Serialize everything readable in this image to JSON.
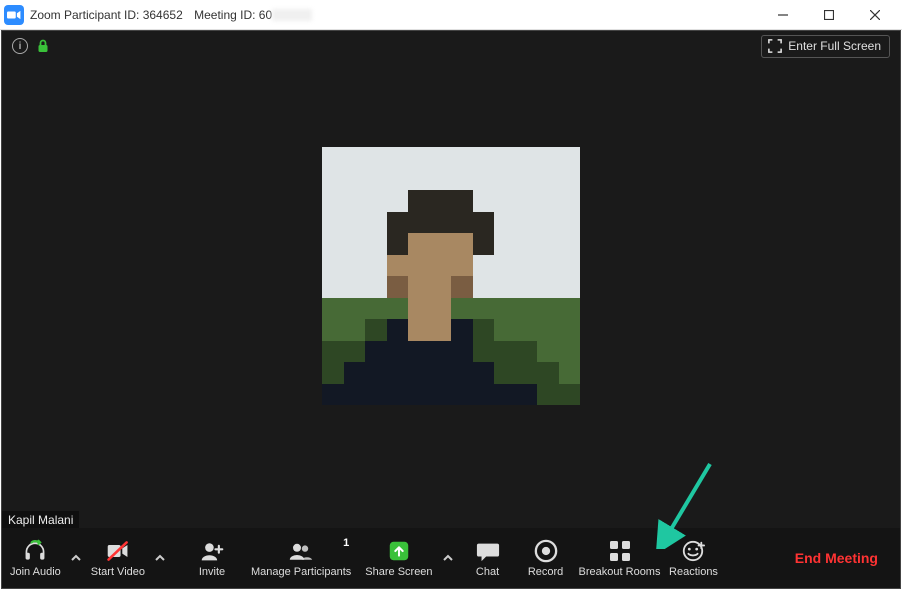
{
  "titlebar": {
    "participant_id_label": "Zoom Participant ID: 364652",
    "meeting_id_label": "Meeting ID: 60"
  },
  "topstrip": {
    "fullscreen_label": "Enter Full Screen"
  },
  "video": {
    "participant_name": "Kapil Malani"
  },
  "toolbar": {
    "join_audio": "Join Audio",
    "start_video": "Start Video",
    "invite": "Invite",
    "manage_participants": "Manage Participants",
    "participants_count": "1",
    "share_screen": "Share Screen",
    "chat": "Chat",
    "record": "Record",
    "breakout_rooms": "Breakout Rooms",
    "reactions": "Reactions",
    "end_meeting": "End Meeting"
  },
  "colors": {
    "accent_green": "#3ac13a",
    "accent_blue": "#2d8cff",
    "end_red": "#ff3333",
    "arrow": "#1fc7a1"
  }
}
